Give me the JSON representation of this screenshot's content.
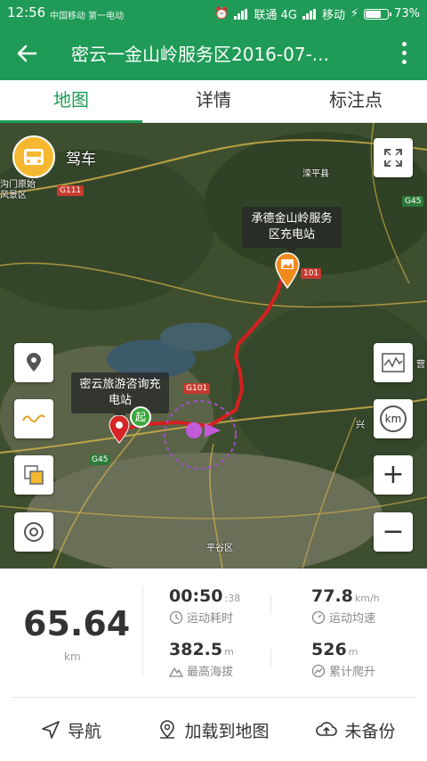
{
  "status_bar": {
    "time": "12:56",
    "carrier_left": "中国移动 第一电动",
    "carrier1": "联通 4G",
    "carrier2": "移动",
    "battery": "73%",
    "battery_level": 0.73
  },
  "app_bar": {
    "title": "密云一金山岭服务区2016-07-..."
  },
  "tabs": [
    {
      "label": "地图",
      "active": true
    },
    {
      "label": "详情",
      "active": false
    },
    {
      "label": "标注点",
      "active": false
    }
  ],
  "map": {
    "drive_mode": "驾车",
    "callout_end": "承德金山岭服务区充电站",
    "callout_start": "密云旅游咨询充电站",
    "start_marker": "起",
    "place_labels": [
      "滦平县",
      "沟门原始",
      "风景区",
      "平谷区",
      "兴",
      "营"
    ],
    "road_labels": [
      "G111",
      "G45",
      "G101",
      "101",
      "G45"
    ],
    "zoom_in": "+",
    "zoom_out": "−",
    "unit_toggle": "km"
  },
  "stats": {
    "distance": "65.64",
    "distance_unit": "km",
    "duration": "00:50",
    "duration_seconds": ":38",
    "duration_label": "运动耗时",
    "speed": "77.8",
    "speed_unit": "km/h",
    "speed_label": "运动均速",
    "altitude": "382.5",
    "altitude_unit": "m",
    "altitude_label": "最高海拔",
    "climb": "526",
    "climb_unit": "m",
    "climb_label": "累计爬升"
  },
  "actions": {
    "navigate": "导航",
    "load_to_map": "加载到地图",
    "backup": "未备份"
  }
}
